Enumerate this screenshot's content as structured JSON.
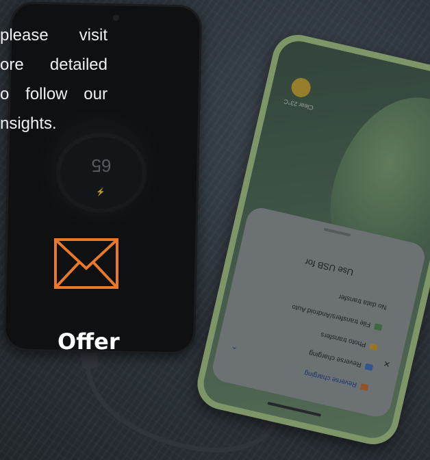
{
  "article": {
    "lines": [
      "please visit",
      "ore detailed",
      "o follow our",
      "nsights."
    ]
  },
  "offer": {
    "label": "Offer",
    "icon": "mail-icon",
    "accent": "#e8782a"
  },
  "left_phone": {
    "charge_value": "65",
    "charge_mode": "Quick charge"
  },
  "right_phone": {
    "weather": "Clear 23°C",
    "usb_dialog": {
      "title": "Use USB for",
      "options": [
        "No data transfer",
        "File transfers/Android Auto",
        "Photo transfers",
        "Reverse charging"
      ]
    }
  },
  "colors": {
    "backdrop": "#2a3036",
    "phone_green": "#a7c585",
    "text": "#eef1f4"
  }
}
